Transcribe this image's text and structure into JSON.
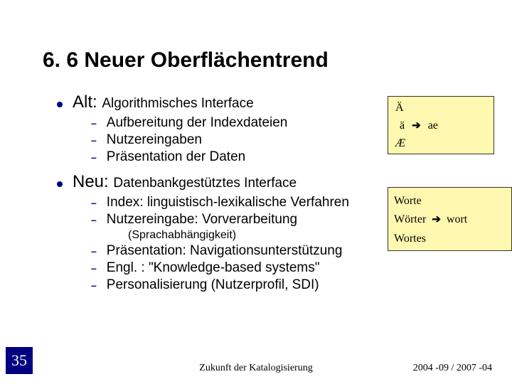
{
  "title": "6. 6 Neuer Oberflächentrend",
  "alt": {
    "label_prefix": "Alt: ",
    "label_emph": "Algorithmisches",
    "label_rest": " Interface",
    "items": [
      "Aufbereitung der Indexdateien",
      "Nutzereingaben",
      "Präsentation der Daten"
    ]
  },
  "neu": {
    "label_prefix": "Neu: ",
    "label_emph": "Datenbankgestütztes",
    "label_rest": " Interface",
    "items_a": [
      "Index: linguistisch-lexikalische Verfahren",
      "Nutzereingabe: Vorverarbeitung"
    ],
    "sprach": "(Sprachabhängigkeit)",
    "items_b": [
      "Präsentation: Navigationsunterstützung",
      "Engl. : \"Knowledge-based systems\"",
      "Personalisierung (Nutzerprofil, SDI)"
    ]
  },
  "box1": {
    "r1": "Ä",
    "r2_a": "ä",
    "r2_arrow": "➔",
    "r2_b": "ae",
    "r3": "Æ"
  },
  "box2": {
    "r1": "Worte",
    "r2_a": "Wörter",
    "r2_arrow": "➔",
    "r2_b": "wort",
    "r3": "Wortes"
  },
  "slide_number": "35",
  "footer_center": "Zukunft der Katalogisierung",
  "footer_right": "2004 -09 / 2007 -04"
}
